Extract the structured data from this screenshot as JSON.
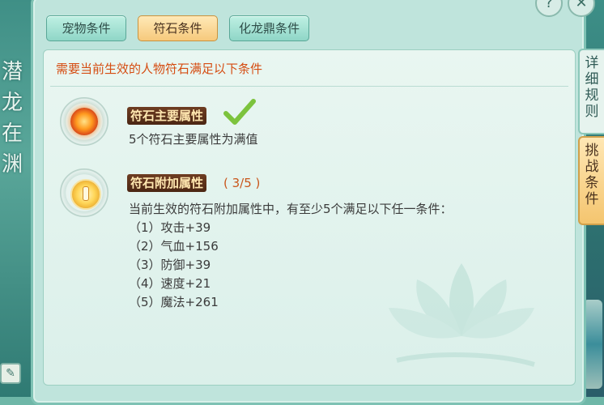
{
  "tabs": [
    {
      "label": "宠物条件",
      "active": false
    },
    {
      "label": "符石条件",
      "active": true
    },
    {
      "label": "化龙鼎条件",
      "active": false
    }
  ],
  "heading": "需要当前生效的人物符石满足以下条件",
  "requirements": {
    "main": {
      "label": "符石主要属性",
      "description": "5个符石主要属性为满值",
      "completed": true,
      "icon": "fire-rune-icon"
    },
    "extra": {
      "label": "符石附加属性",
      "progress": "( 3/5 )",
      "description": "当前生效的符石附加属性中，有至少5个满足以下任一条件：",
      "icon": "gold-rune-icon",
      "conditions": [
        "（1）攻击+39",
        "（2）气血+156",
        "（3）防御+39",
        "（4）速度+21",
        "（5）魔法+261"
      ]
    }
  },
  "side_tabs": {
    "rules": "详细规则",
    "challenge": "挑战条件"
  },
  "top_buttons": {
    "help": "?",
    "close": "✕"
  },
  "left_calligraphy": "潜龙在渊",
  "colors": {
    "heading": "#d54d12",
    "progress": "#c9561b",
    "check": "#7cc33d",
    "active_tab": "#f6c97c",
    "inactive_tab": "#8fd6c7"
  }
}
